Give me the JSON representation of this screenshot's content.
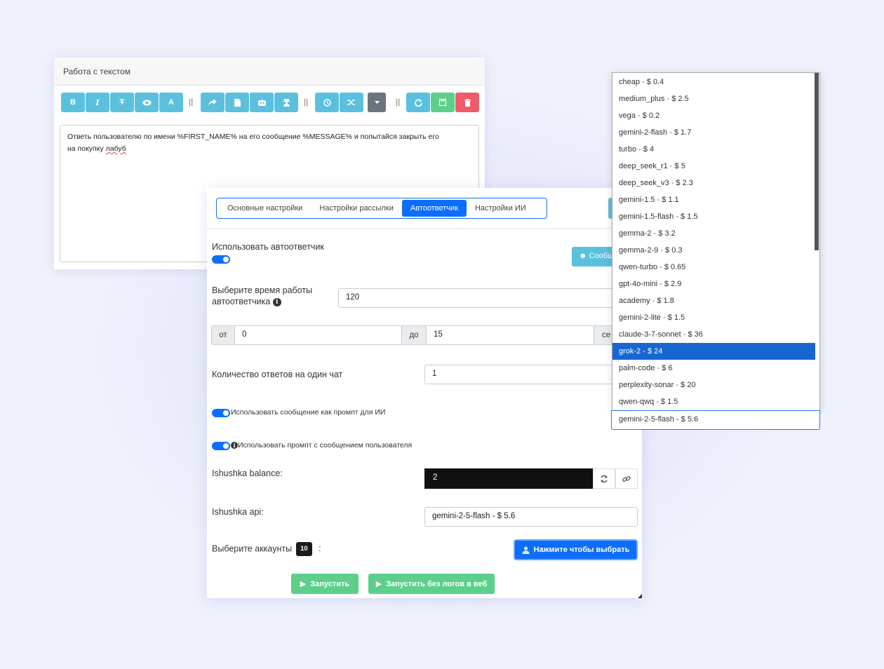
{
  "editor": {
    "title": "Работа с текстом",
    "toolbar": {
      "bold": "B",
      "italic": "I",
      "font": "A",
      "separator": "||"
    },
    "text_line1": "Ответь пользователю по имени %FIRST_NAME% на его сообщение %MESSAGE% и попытайся закрыть его",
    "text_line2_pre": "на покупку ",
    "text_line2_word": "лабуб"
  },
  "settings": {
    "tabs": [
      "Основные настройки",
      "Настройки рассылки",
      "Автоответчик",
      "Настройки ИИ"
    ],
    "active_tab": "Автоответчик",
    "use_autoresponder_label": "Использовать автоответчик",
    "message_button_label": "Сообщ",
    "work_time_label_line1": "Выберите время работы",
    "work_time_label_line2": "автоответчика",
    "work_time_value": "120",
    "from_label": "от",
    "from_value": "0",
    "to_label": "до",
    "to_value": "15",
    "sec_label": "се",
    "answers_per_chat_label": "Количество ответов на один чат",
    "answers_per_chat_value": "1",
    "use_message_as_prompt_label": "Использовать сообщение как промпт для ИИ",
    "use_prompt_with_message_label": "Использовать промпт с сообщением пользователя",
    "balance_label": "Ishushka balance:",
    "balance_value": "2",
    "api_label": "Ishushka api:",
    "api_value": "gemini-2-5-flash - $ 5.6",
    "accounts_label": "Выберите аккаунты",
    "accounts_count": "10",
    "accounts_colon": ":",
    "choose_button_label": "Нажмите чтобы выбрать",
    "run_button_label": "Запустить",
    "run_no_logs_button_label": "Запустить без логов в веб"
  },
  "dropdown": {
    "options": [
      {
        "name": "cheap",
        "price": "$ 0.4"
      },
      {
        "name": "medium_plus",
        "price": "$ 2.5"
      },
      {
        "name": "vega",
        "price": "$ 0.2"
      },
      {
        "name": "gemini-2-flash",
        "price": "$ 1.7"
      },
      {
        "name": "turbo",
        "price": "$ 4"
      },
      {
        "name": "deep_seek_r1",
        "price": "$ 5"
      },
      {
        "name": "deep_seek_v3",
        "price": "$ 2.3"
      },
      {
        "name": "gemini-1.5",
        "price": "$ 1.1"
      },
      {
        "name": "gemini-1.5-flash",
        "price": "$ 1.5"
      },
      {
        "name": "gemma-2",
        "price": "$ 3.2"
      },
      {
        "name": "gemma-2-9",
        "price": "$ 0.3"
      },
      {
        "name": "qwen-turbo",
        "price": "$ 0.65"
      },
      {
        "name": "gpt-4o-mini",
        "price": "$ 2.9"
      },
      {
        "name": "academy",
        "price": "$ 1.8"
      },
      {
        "name": "gemini-2-lite",
        "price": "$ 1.5"
      },
      {
        "name": "claude-3-7-sonnet",
        "price": "$ 36"
      },
      {
        "name": "grok-2",
        "price": "$ 24"
      },
      {
        "name": "palm-code",
        "price": "$ 6"
      },
      {
        "name": "perplexity-sonar",
        "price": "$ 20"
      },
      {
        "name": "qwen-qwq",
        "price": "$ 1.5"
      }
    ],
    "highlighted": "grok-2",
    "selected_value": "gemini-2-5-flash - $ 5.6"
  }
}
